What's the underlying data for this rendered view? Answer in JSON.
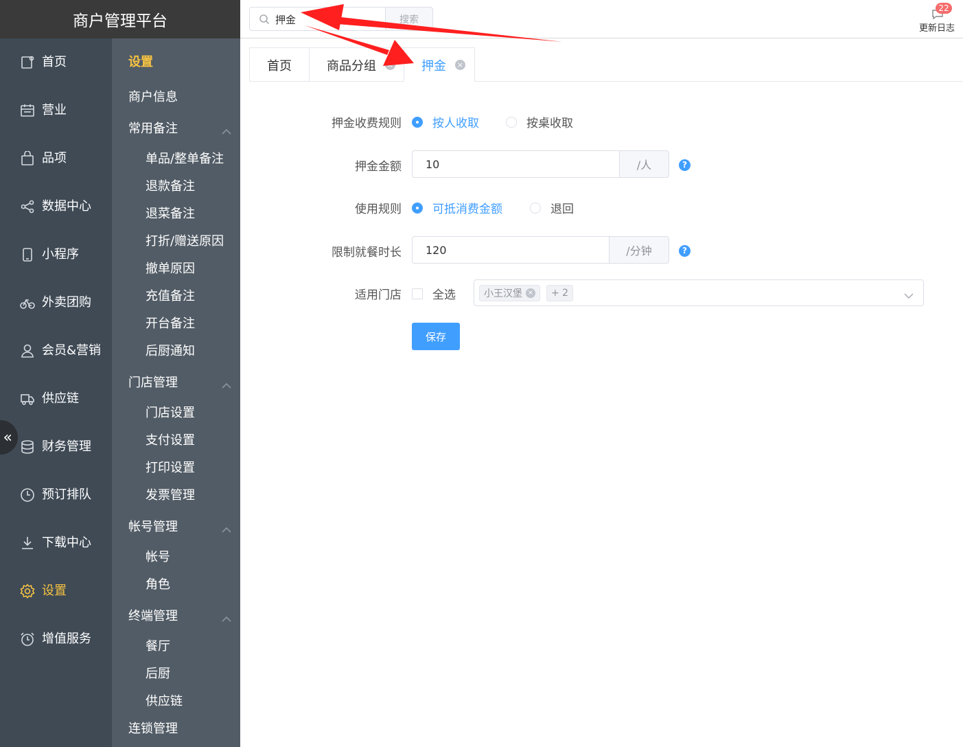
{
  "app": {
    "title": "商户管理平台"
  },
  "main_nav": [
    {
      "label": "首页",
      "icon": "home-icon",
      "active": false
    },
    {
      "label": "营业",
      "icon": "calendar-icon",
      "active": false
    },
    {
      "label": "品项",
      "icon": "bag-icon",
      "active": false
    },
    {
      "label": "数据中心",
      "icon": "share-icon",
      "active": false
    },
    {
      "label": "小程序",
      "icon": "phone-icon",
      "active": false
    },
    {
      "label": "外卖团购",
      "icon": "bike-icon",
      "active": false
    },
    {
      "label": "会员&营销",
      "icon": "user-icon",
      "active": false
    },
    {
      "label": "供应链",
      "icon": "truck-icon",
      "active": false
    },
    {
      "label": "财务管理",
      "icon": "database-icon",
      "active": false
    },
    {
      "label": "预订排队",
      "icon": "clock-icon",
      "active": false
    },
    {
      "label": "下载中心",
      "icon": "download-icon",
      "active": false
    },
    {
      "label": "设置",
      "icon": "gear-icon",
      "active": true
    },
    {
      "label": "增值服务",
      "icon": "alarm-icon",
      "active": false
    }
  ],
  "collapse_glyph": "«",
  "sub_nav": {
    "title": "设置",
    "top_item": "商户信息",
    "groups": [
      {
        "label": "常用备注",
        "items": [
          "单品/整单备注",
          "退款备注",
          "退菜备注",
          "打折/赠送原因",
          "撤单原因",
          "充值备注",
          "开台备注",
          "后厨通知"
        ]
      },
      {
        "label": "门店管理",
        "items": [
          "门店设置",
          "支付设置",
          "打印设置",
          "发票管理"
        ]
      },
      {
        "label": "帐号管理",
        "items": [
          "帐号",
          "角色"
        ]
      },
      {
        "label": "终端管理",
        "items": [
          "餐厅",
          "后厨",
          "供应链"
        ]
      }
    ],
    "bottom_item": "连锁管理"
  },
  "header": {
    "search_value": "押金",
    "search_button": "搜索",
    "changelog_label": "更新日志",
    "changelog_badge": "22"
  },
  "tabs": [
    {
      "label": "首页",
      "closable": false,
      "active": false
    },
    {
      "label": "商品分组",
      "closable": true,
      "active": false
    },
    {
      "label": "押金",
      "closable": true,
      "active": true
    }
  ],
  "form": {
    "rule_label": "押金收费规则",
    "rule_options": [
      {
        "label": "按人收取",
        "checked": true
      },
      {
        "label": "按桌收取",
        "checked": false
      }
    ],
    "amount_label": "押金金额",
    "amount_value": "10",
    "amount_unit": "/人",
    "usage_label": "使用规则",
    "usage_options": [
      {
        "label": "可抵消费金额",
        "checked": true
      },
      {
        "label": "退回",
        "checked": false
      }
    ],
    "duration_label": "限制就餐时长",
    "duration_value": "120",
    "duration_unit": "/分钟",
    "help_glyph": "?",
    "store_label": "适用门店",
    "select_all_label": "全选",
    "selected_store_tag": "小王汉堡",
    "more_tag": "+ 2",
    "save_label": "保存"
  },
  "colors": {
    "primary": "#409eff",
    "nav_bg": "#3f4a55",
    "sub_nav_bg": "#525c66",
    "accent": "#f5c242",
    "arrow": "#ff1f1f"
  }
}
